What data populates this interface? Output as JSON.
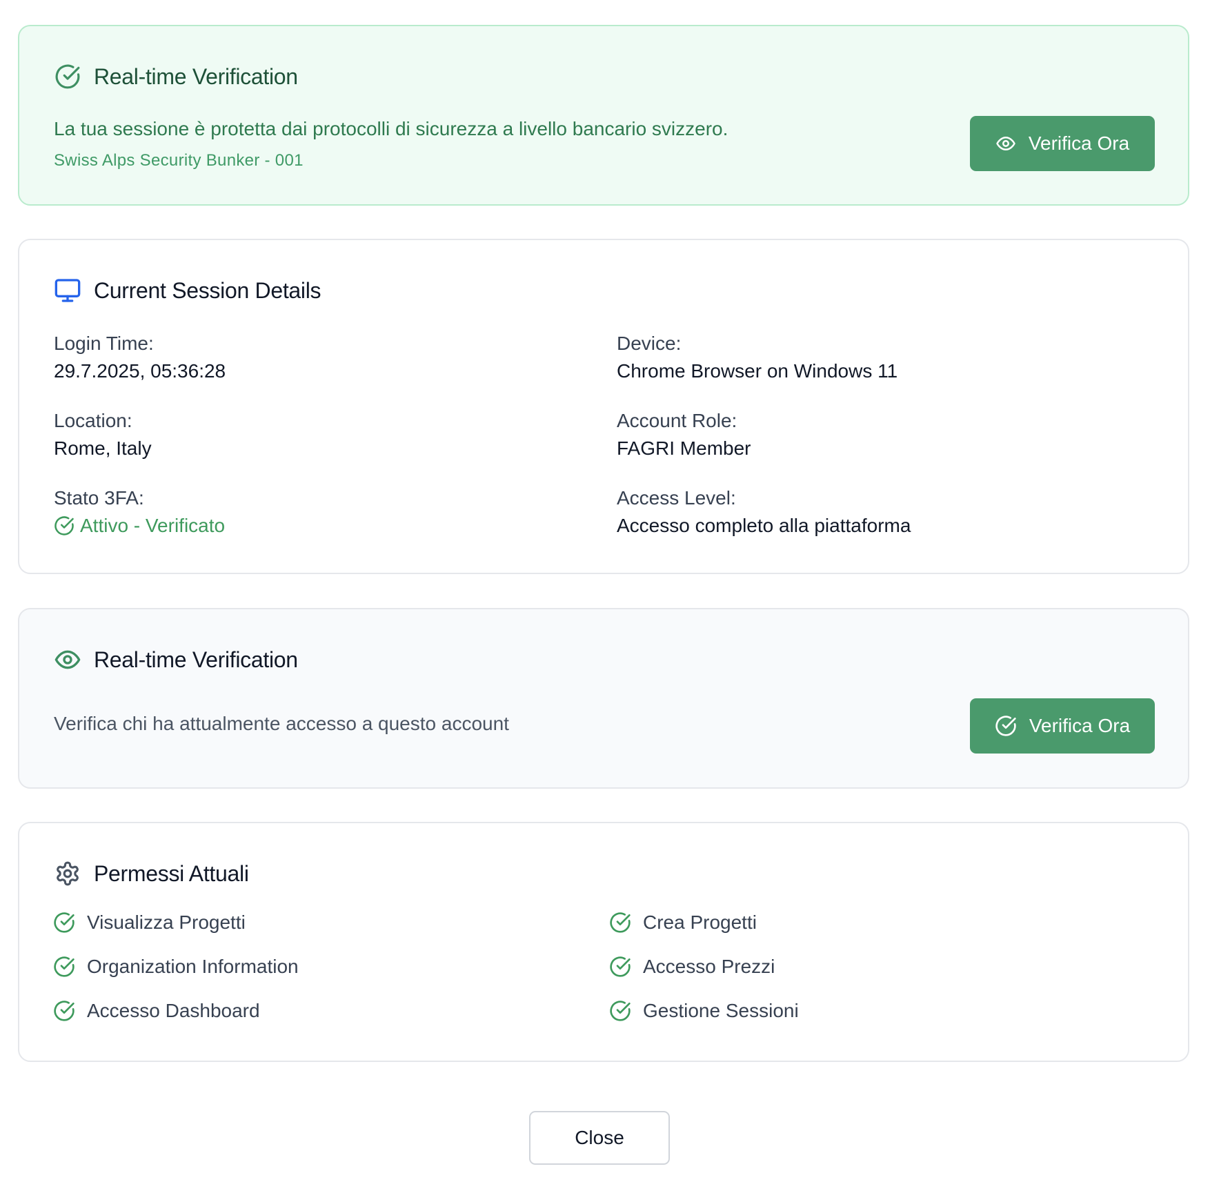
{
  "security_banner": {
    "title": "Real-time Verification",
    "icon": "check-circle-icon",
    "description": "La tua sessione è protetta dai protocolli di sicurezza a livello bancario svizzero.",
    "server": "Swiss Alps Security Bunker - 001",
    "button_label": "Verifica Ora",
    "button_icon": "eye-icon",
    "accent_color": "#4a9a6c",
    "background_color": "#effbf4"
  },
  "session": {
    "title": "Current Session Details",
    "icon": "monitor-icon",
    "login_time_label": "Login Time:",
    "login_time_value": "29.7.2025, 05:36:28",
    "device_label": "Device:",
    "device_value": "Chrome Browser on Windows 11",
    "location_label": "Location:",
    "location_value": "Rome, Italy",
    "role_label": "Account Role:",
    "role_value": "FAGRI Member",
    "mfa_label": "Stato 3FA:",
    "mfa_value": "Attivo - Verificato",
    "access_label": "Access Level:",
    "access_value": "Accesso completo alla piattaforma"
  },
  "verification": {
    "title": "Real-time Verification",
    "icon": "eye-icon",
    "description": "Verifica chi ha attualmente accesso a questo account",
    "button_label": "Verifica Ora",
    "button_icon": "check-circle-icon"
  },
  "permissions": {
    "title": "Permessi Attuali",
    "icon": "gear-icon",
    "items": [
      "Visualizza Progetti",
      "Crea Progetti",
      "Organization Information",
      "Accesso Prezzi",
      "Accesso Dashboard",
      "Gestione Sessioni"
    ]
  },
  "footer": {
    "close_label": "Close"
  }
}
